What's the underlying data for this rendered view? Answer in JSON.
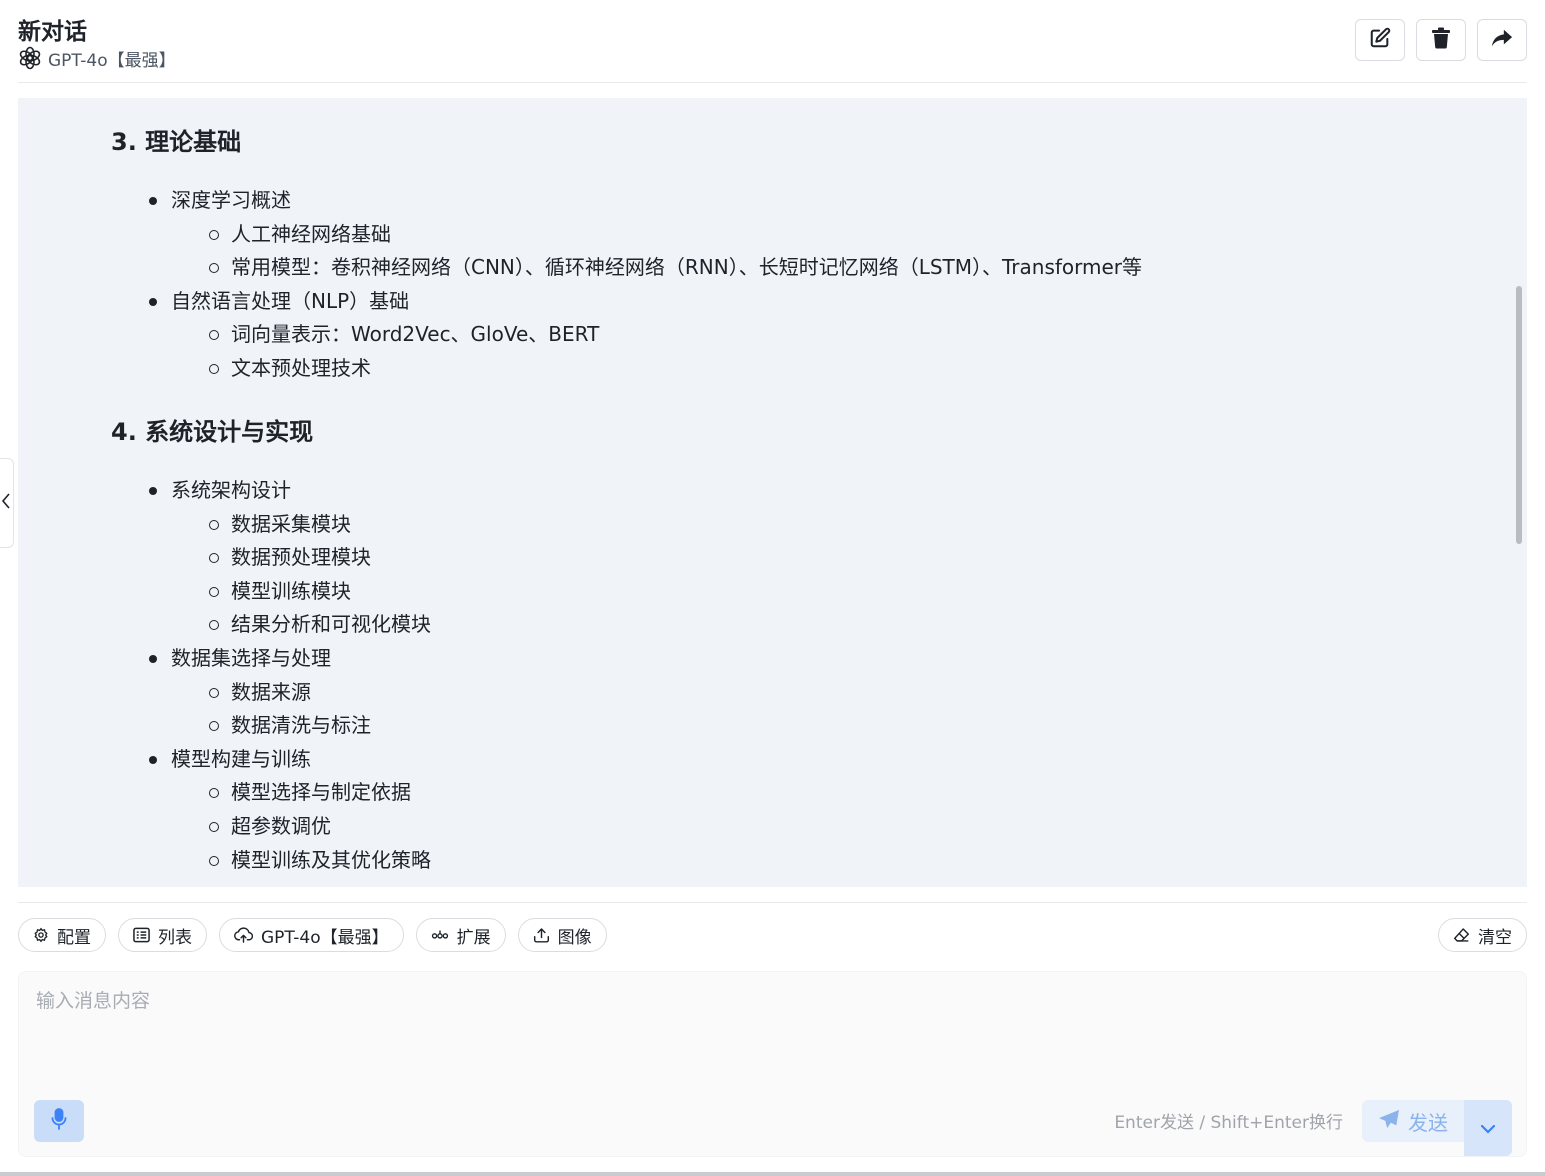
{
  "header": {
    "title": "新对话",
    "model_label": "GPT-4o【最强】"
  },
  "content": {
    "sections": [
      {
        "heading": "3. 理论基础",
        "items": [
          {
            "label": "深度学习概述",
            "children": [
              "人工神经网络基础",
              "常用模型：卷积神经网络（CNN）、循环神经网络（RNN）、长短时记忆网络（LSTM）、Transformer等"
            ]
          },
          {
            "label": "自然语言处理（NLP）基础",
            "children": [
              "词向量表示：Word2Vec、GloVe、BERT",
              "文本预处理技术"
            ]
          }
        ]
      },
      {
        "heading": "4. 系统设计与实现",
        "items": [
          {
            "label": "系统架构设计",
            "children": [
              "数据采集模块",
              "数据预处理模块",
              "模型训练模块",
              "结果分析和可视化模块"
            ]
          },
          {
            "label": "数据集选择与处理",
            "children": [
              "数据来源",
              "数据清洗与标注"
            ]
          },
          {
            "label": "模型构建与训练",
            "children": [
              "模型选择与制定依据",
              "超参数调优",
              "模型训练及其优化策略"
            ]
          }
        ]
      }
    ]
  },
  "toolbar": {
    "config": "配置",
    "list": "列表",
    "model": "GPT-4o【最强】",
    "extend": "扩展",
    "image": "图像",
    "clear": "清空"
  },
  "composer": {
    "placeholder": "输入消息内容",
    "hint": "Enter发送 / Shift+Enter换行",
    "send": "发送"
  },
  "colors": {
    "content_bg": "#f0f4f9",
    "accent": "#8ab2eb",
    "mic_bg": "#c9dcf8"
  }
}
